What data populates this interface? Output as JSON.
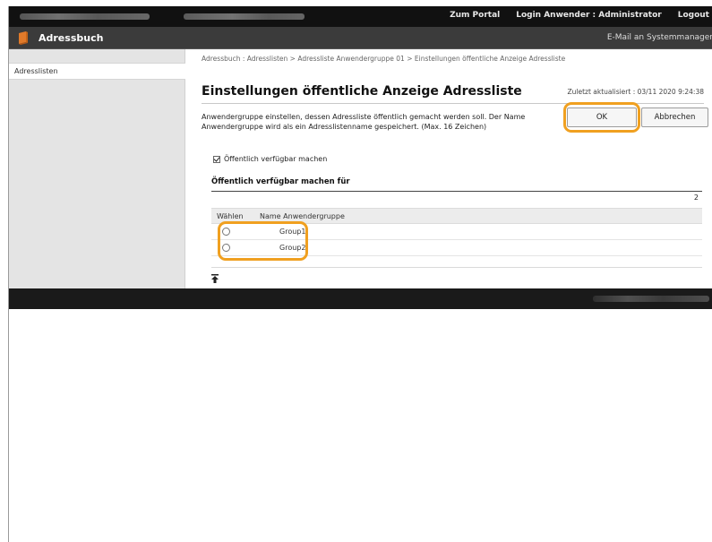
{
  "topbar": {
    "portal_link": "Zum Portal",
    "login_label": "Login Anwender : Administrator",
    "logout_link": "Logout"
  },
  "header": {
    "title": "Adressbuch",
    "email_link": "E-Mail an Systemmanager"
  },
  "sidebar": {
    "items": [
      {
        "label": "Adresslisten"
      }
    ]
  },
  "main": {
    "breadcrumb": "Adressbuch : Adresslisten > Adressliste Anwendergruppe 01 > Einstellungen öffentliche Anzeige Adressliste",
    "title": "Einstellungen öffentliche Anzeige Adressliste",
    "updated": "Zuletzt aktualisiert : 03/11 2020 9:24:38",
    "description": "Anwendergruppe einstellen, dessen Adressliste öffentlich gemacht werden soll. Der Name Anwendergruppe wird als ein Adresslistenname gespeichert. (Max. 16 Zeichen)",
    "ok_label": "OK",
    "cancel_label": "Abbrechen",
    "checkbox_label": "Öffentlich verfügbar machen",
    "checkbox_checked": true,
    "section_title": "Öffentlich verfügbar machen für",
    "count": "2",
    "table": {
      "headers": [
        "Wählen",
        "Name Anwendergruppe"
      ],
      "rows": [
        {
          "name": "Group1",
          "selected": false
        },
        {
          "name": "Group2",
          "selected": false
        }
      ]
    }
  },
  "colors": {
    "highlight": "#f0a020",
    "topbar": "#111111",
    "header": "#3b3b3b"
  },
  "icons": {
    "header": "address-book-icon",
    "scroll_top": "scroll-to-top-icon"
  }
}
